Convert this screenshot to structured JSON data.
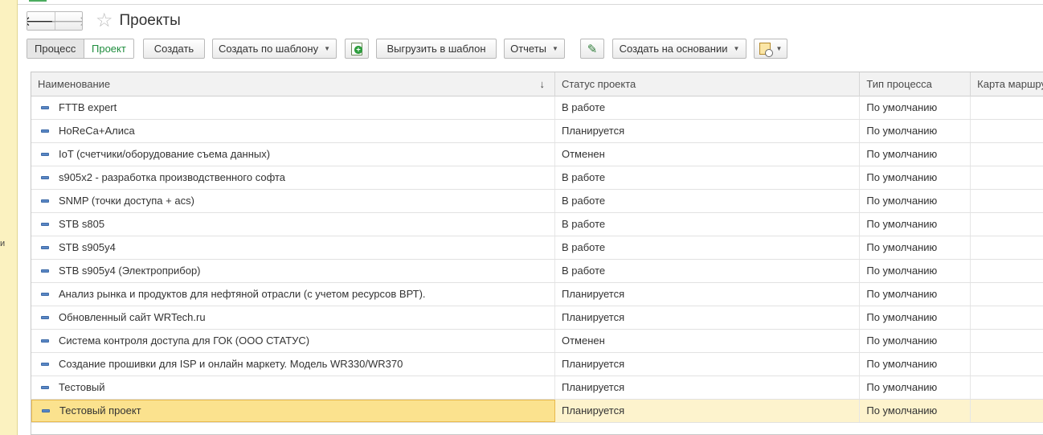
{
  "sidebar_strip": {
    "text": "и"
  },
  "header": {
    "back_icon": "arrow-left-icon",
    "forward_icon": "arrow-right-icon",
    "favorite_icon": "star-icon",
    "title": "Проекты"
  },
  "toolbar": {
    "mode_process": "Процесс",
    "mode_project": "Проект",
    "create": "Создать",
    "create_by_template": "Создать по шаблону",
    "add_icon": "document-add-icon",
    "export_to_template": "Выгрузить в шаблон",
    "reports": "Отчеты",
    "edit_icon": "pen-icon",
    "create_based_on": "Создать на основании",
    "calendar_icon": "calendar-clock-icon"
  },
  "table": {
    "columns": [
      "Наименование",
      "Статус проекта",
      "Тип процесса",
      "Карта маршрута"
    ],
    "sort_indicator": "↓",
    "rows": [
      {
        "name": "FTTB expert",
        "status": "В работе",
        "type": "По умолчанию",
        "map": ""
      },
      {
        "name": "HoReCa+Алиса",
        "status": "Планируется",
        "type": "По умолчанию",
        "map": ""
      },
      {
        "name": "IoT (счетчики/оборудование съема данных)",
        "status": "Отменен",
        "type": "По умолчанию",
        "map": ""
      },
      {
        "name": "s905x2 - разработка производственного софта",
        "status": "В работе",
        "type": "По умолчанию",
        "map": ""
      },
      {
        "name": "SNMP (точки доступа + acs)",
        "status": "В работе",
        "type": "По умолчанию",
        "map": ""
      },
      {
        "name": "STB s805",
        "status": "В работе",
        "type": "По умолчанию",
        "map": ""
      },
      {
        "name": "STB s905y4",
        "status": "В работе",
        "type": "По умолчанию",
        "map": ""
      },
      {
        "name": "STB s905y4 (Электроприбор)",
        "status": "В работе",
        "type": "По умолчанию",
        "map": ""
      },
      {
        "name": "Анализ рынка и продуктов для нефтяной отрасли (с учетом ресурсов ВРТ).",
        "status": "Планируется",
        "type": "По умолчанию",
        "map": ""
      },
      {
        "name": "Обновленный сайт WRTech.ru",
        "status": "Планируется",
        "type": "По умолчанию",
        "map": ""
      },
      {
        "name": "Система контроля доступа для ГОК (ООО СТАТУС)",
        "status": "Отменен",
        "type": "По умолчанию",
        "map": ""
      },
      {
        "name": "Создание прошивки  для ISP и онлайн маркету. Модель WR330/WR370",
        "status": "Планируется",
        "type": "По умолчанию",
        "map": ""
      },
      {
        "name": "Тестовый",
        "status": "Планируется",
        "type": "По умолчанию",
        "map": ""
      },
      {
        "name": "Тестовый проект",
        "status": "Планируется",
        "type": "По умолчанию",
        "map": "",
        "selected": true
      }
    ]
  }
}
